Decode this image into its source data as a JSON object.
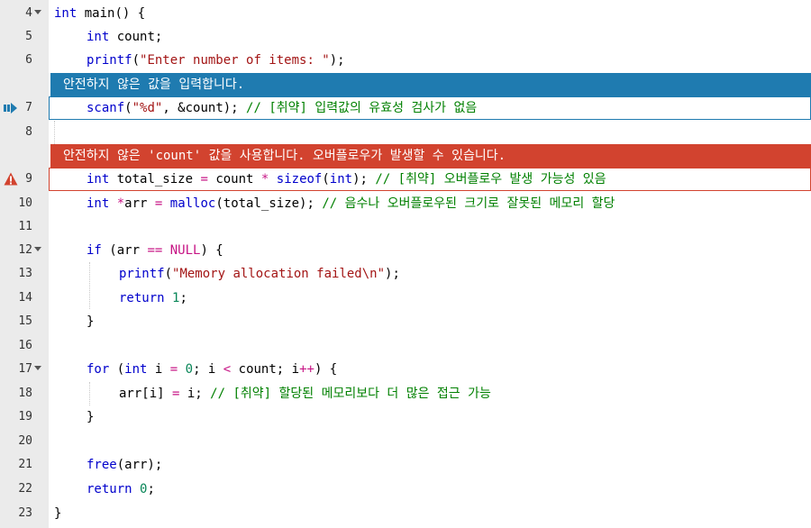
{
  "editor": {
    "banners": {
      "info": "안전하지 않은 값을 입력합니다.",
      "error": "안전하지 않은 'count' 값을 사용합니다. 오버플로우가 발생할 수 있습니다."
    },
    "lines": [
      {
        "n": "4"
      },
      {
        "n": "5"
      },
      {
        "n": "6"
      },
      {
        "n": "7"
      },
      {
        "n": "8"
      },
      {
        "n": "9"
      },
      {
        "n": "10"
      },
      {
        "n": "11"
      },
      {
        "n": "12"
      },
      {
        "n": "13"
      },
      {
        "n": "14"
      },
      {
        "n": "15"
      },
      {
        "n": "16"
      },
      {
        "n": "17"
      },
      {
        "n": "18"
      },
      {
        "n": "19"
      },
      {
        "n": "20"
      },
      {
        "n": "21"
      },
      {
        "n": "22"
      },
      {
        "n": "23"
      }
    ],
    "tokens": {
      "l4": [
        "int",
        " main() {"
      ],
      "l5": [
        "int",
        " count;"
      ],
      "l6": [
        "printf",
        "(",
        "\"Enter number of items: \"",
        ");"
      ],
      "l7": [
        "scanf",
        "(",
        "\"%d\"",
        ", &count); ",
        "// [취약] 입력값의 유효성 검사가 없음"
      ],
      "l9": [
        "int",
        " total_size ",
        "=",
        " count ",
        "*",
        " ",
        "sizeof",
        "(",
        "int",
        "); ",
        "// [취약] 오버플로우 발생 가능성 있음"
      ],
      "l10": [
        "int",
        " ",
        "*",
        "arr ",
        "=",
        " ",
        "malloc",
        "(total_size); ",
        "// 음수나 오버플로우된 크기로 잘못된 메모리 할당"
      ],
      "l12": [
        "if",
        " (arr ",
        "==",
        " ",
        "NULL",
        ") {"
      ],
      "l13": [
        "printf",
        "(",
        "\"Memory allocation failed\\n\"",
        ");"
      ],
      "l14": [
        "return",
        " ",
        "1",
        ";"
      ],
      "l15": [
        "}"
      ],
      "l17": [
        "for",
        " (",
        "int",
        " i ",
        "=",
        " ",
        "0",
        "; i ",
        "<",
        " count; i",
        "++",
        ") {"
      ],
      "l18": [
        "arr[i] ",
        "=",
        " i; ",
        "// [취약] 할당된 메모리보다 더 많은 접근 가능"
      ],
      "l19": [
        "}"
      ],
      "l21": [
        "free",
        "(arr);"
      ],
      "l22": [
        "return",
        " ",
        "0",
        ";"
      ],
      "l23": [
        "}"
      ]
    }
  }
}
